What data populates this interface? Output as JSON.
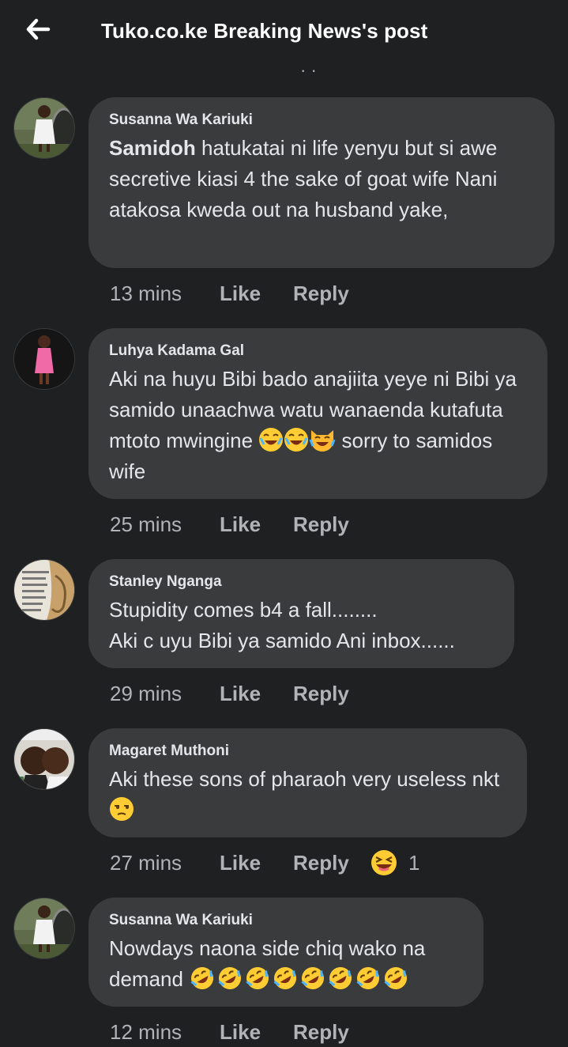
{
  "header": {
    "title": "Tuko.co.ke Breaking News's post",
    "back_icon": "arrow-left-icon"
  },
  "clipped_row_text": "· ·",
  "actions": {
    "like": "Like",
    "reply": "Reply"
  },
  "comments": [
    {
      "author": "Susanna Wa Kariuki",
      "mention": "Samidoh",
      "text": " hatukatai ni life yenyu but si awe secretive  kiasi 4 the sake of goat wife Nani atakosa kweda out na husband yake,",
      "time": "13 mins"
    },
    {
      "author": "Luhya Kadama Gal",
      "text": "Aki na huyu Bibi bado anajiita yeye ni Bibi ya samido unaachwa watu wanaenda kutafuta mtoto mwingine",
      "text_after": " sorry to samidos wife",
      "emojis": [
        "joy",
        "joy",
        "joy-cat"
      ],
      "time": "25 mins"
    },
    {
      "author": "Stanley Nganga",
      "line1": "Stupidity comes b4 a fall........",
      "line2": "Aki c uyu Bibi ya samido Ani inbox......",
      "time": "29 mins"
    },
    {
      "author": "Magaret Muthoni",
      "text": "Aki these sons of pharaoh very useless nkt",
      "emojis": [
        "unamused"
      ],
      "time": "27 mins",
      "reaction": {
        "emoji": "laughing",
        "count": "1"
      }
    },
    {
      "author": "Susanna Wa Kariuki",
      "text": "Nowdays naona side chiq wako na demand ",
      "emojis": [
        "rofl",
        "rofl",
        "rofl",
        "rofl",
        "rofl",
        "rofl",
        "rofl",
        "rofl"
      ],
      "time": "12 mins"
    }
  ]
}
